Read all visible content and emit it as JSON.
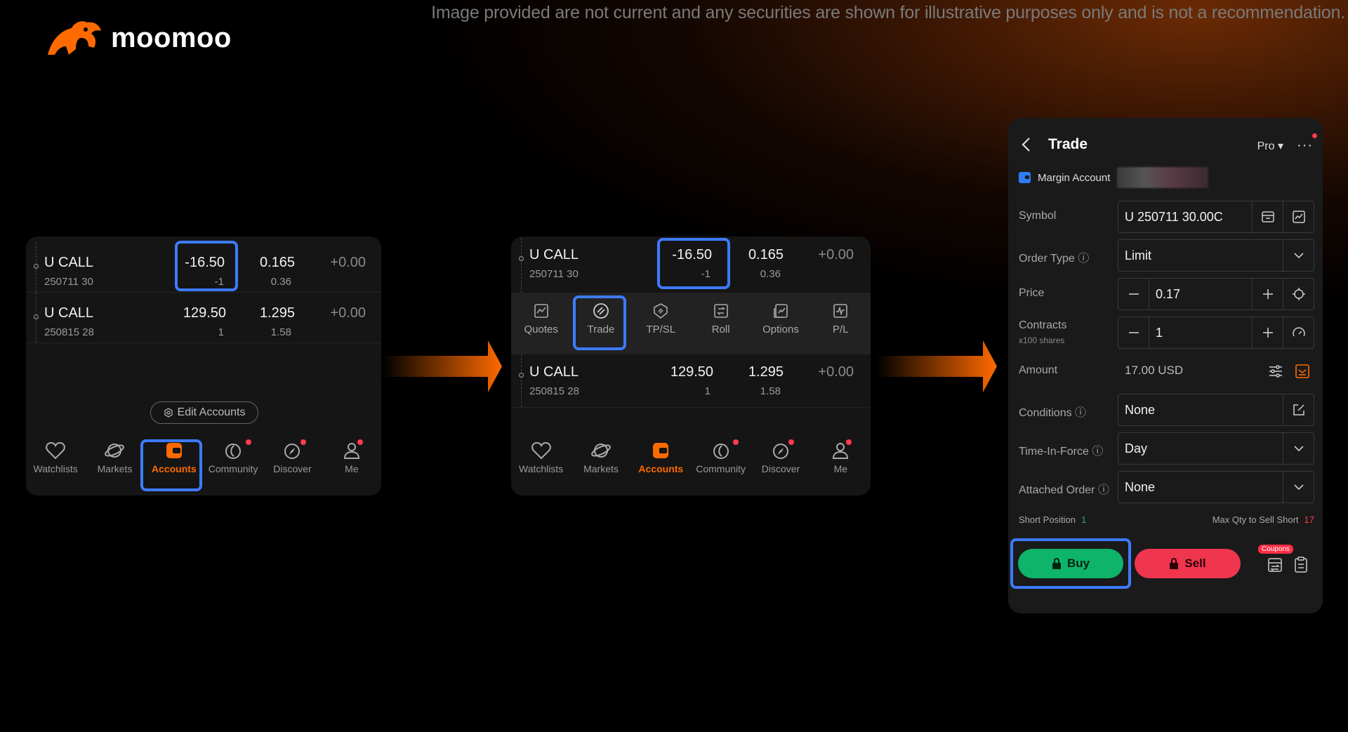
{
  "disclaimer": "Image provided are not current and any securities are shown for illustrative purposes only and is not a recommendation.",
  "brand": {
    "name": "moomoo",
    "accent": "#ff6a00",
    "highlight": "#3d7bff"
  },
  "positions": [
    {
      "symbol": "U CALL",
      "expiry": "250711 30",
      "qty": "-16.50",
      "qty_sub": "-1",
      "price": "0.165",
      "price_sub": "0.36",
      "change": "+0.00"
    },
    {
      "symbol": "U CALL",
      "expiry": "250815 28",
      "qty": "129.50",
      "qty_sub": "1",
      "price": "1.295",
      "price_sub": "1.58",
      "change": "+0.00"
    }
  ],
  "edit_accounts": "Edit Accounts",
  "tabs": [
    {
      "label": "Watchlists",
      "icon": "heart-icon"
    },
    {
      "label": "Markets",
      "icon": "planet-icon"
    },
    {
      "label": "Accounts",
      "icon": "wallet-icon"
    },
    {
      "label": "Community",
      "icon": "moon-icon"
    },
    {
      "label": "Discover",
      "icon": "compass-icon"
    },
    {
      "label": "Me",
      "icon": "person-icon"
    }
  ],
  "actions": [
    {
      "label": "Quotes",
      "icon": "chart-icon"
    },
    {
      "label": "Trade",
      "icon": "trade-icon"
    },
    {
      "label": "TP/SL",
      "icon": "shield-icon"
    },
    {
      "label": "Roll",
      "icon": "roll-icon"
    },
    {
      "label": "Options",
      "icon": "options-icon"
    },
    {
      "label": "P/L",
      "icon": "pl-icon"
    }
  ],
  "trade": {
    "title": "Trade",
    "pro": "Pro",
    "more": "···",
    "account": "Margin Account",
    "symbol_label": "Symbol",
    "symbol_value": "U 250711 30.00C",
    "order_type_label": "Order Type ⓘ",
    "order_type_value": "Limit",
    "price_label": "Price",
    "price_value": "0.17",
    "contracts_label": "Contracts",
    "contracts_sub": "x100 shares",
    "contracts_value": "1",
    "amount_label": "Amount",
    "amount_value": "17.00 USD",
    "conditions_label": "Conditions ⓘ",
    "conditions_value": "None",
    "tif_label": "Time-In-Force ⓘ",
    "tif_value": "Day",
    "attached_label": "Attached Order ⓘ",
    "attached_value": "None",
    "short_position_label": "Short Position",
    "short_position_value": "1",
    "max_qty_label": "Max Qty to Sell Short",
    "max_qty_value": "17",
    "buy": "Buy",
    "sell": "Sell",
    "coupons": "Coupons"
  }
}
